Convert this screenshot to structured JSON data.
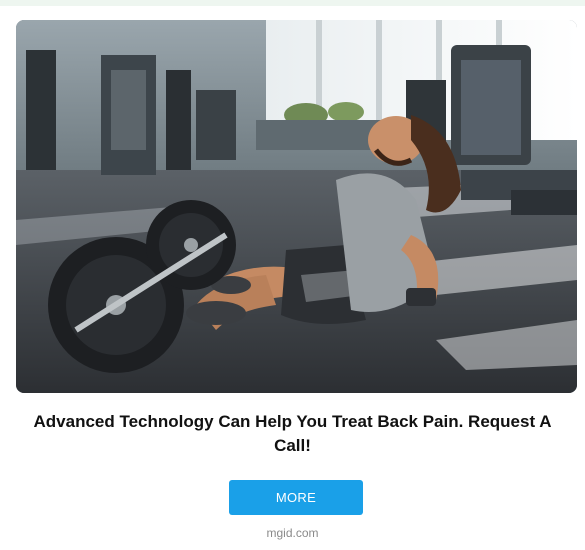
{
  "ad": {
    "title": "Advanced Technology Can Help You Treat Back Pain. Request A Call!",
    "button_label": "MORE",
    "source": "mgid.com",
    "image_alt": "Man sitting on gym floor holding his lower back next to a barbell",
    "button_color": "#1aa0e8"
  }
}
